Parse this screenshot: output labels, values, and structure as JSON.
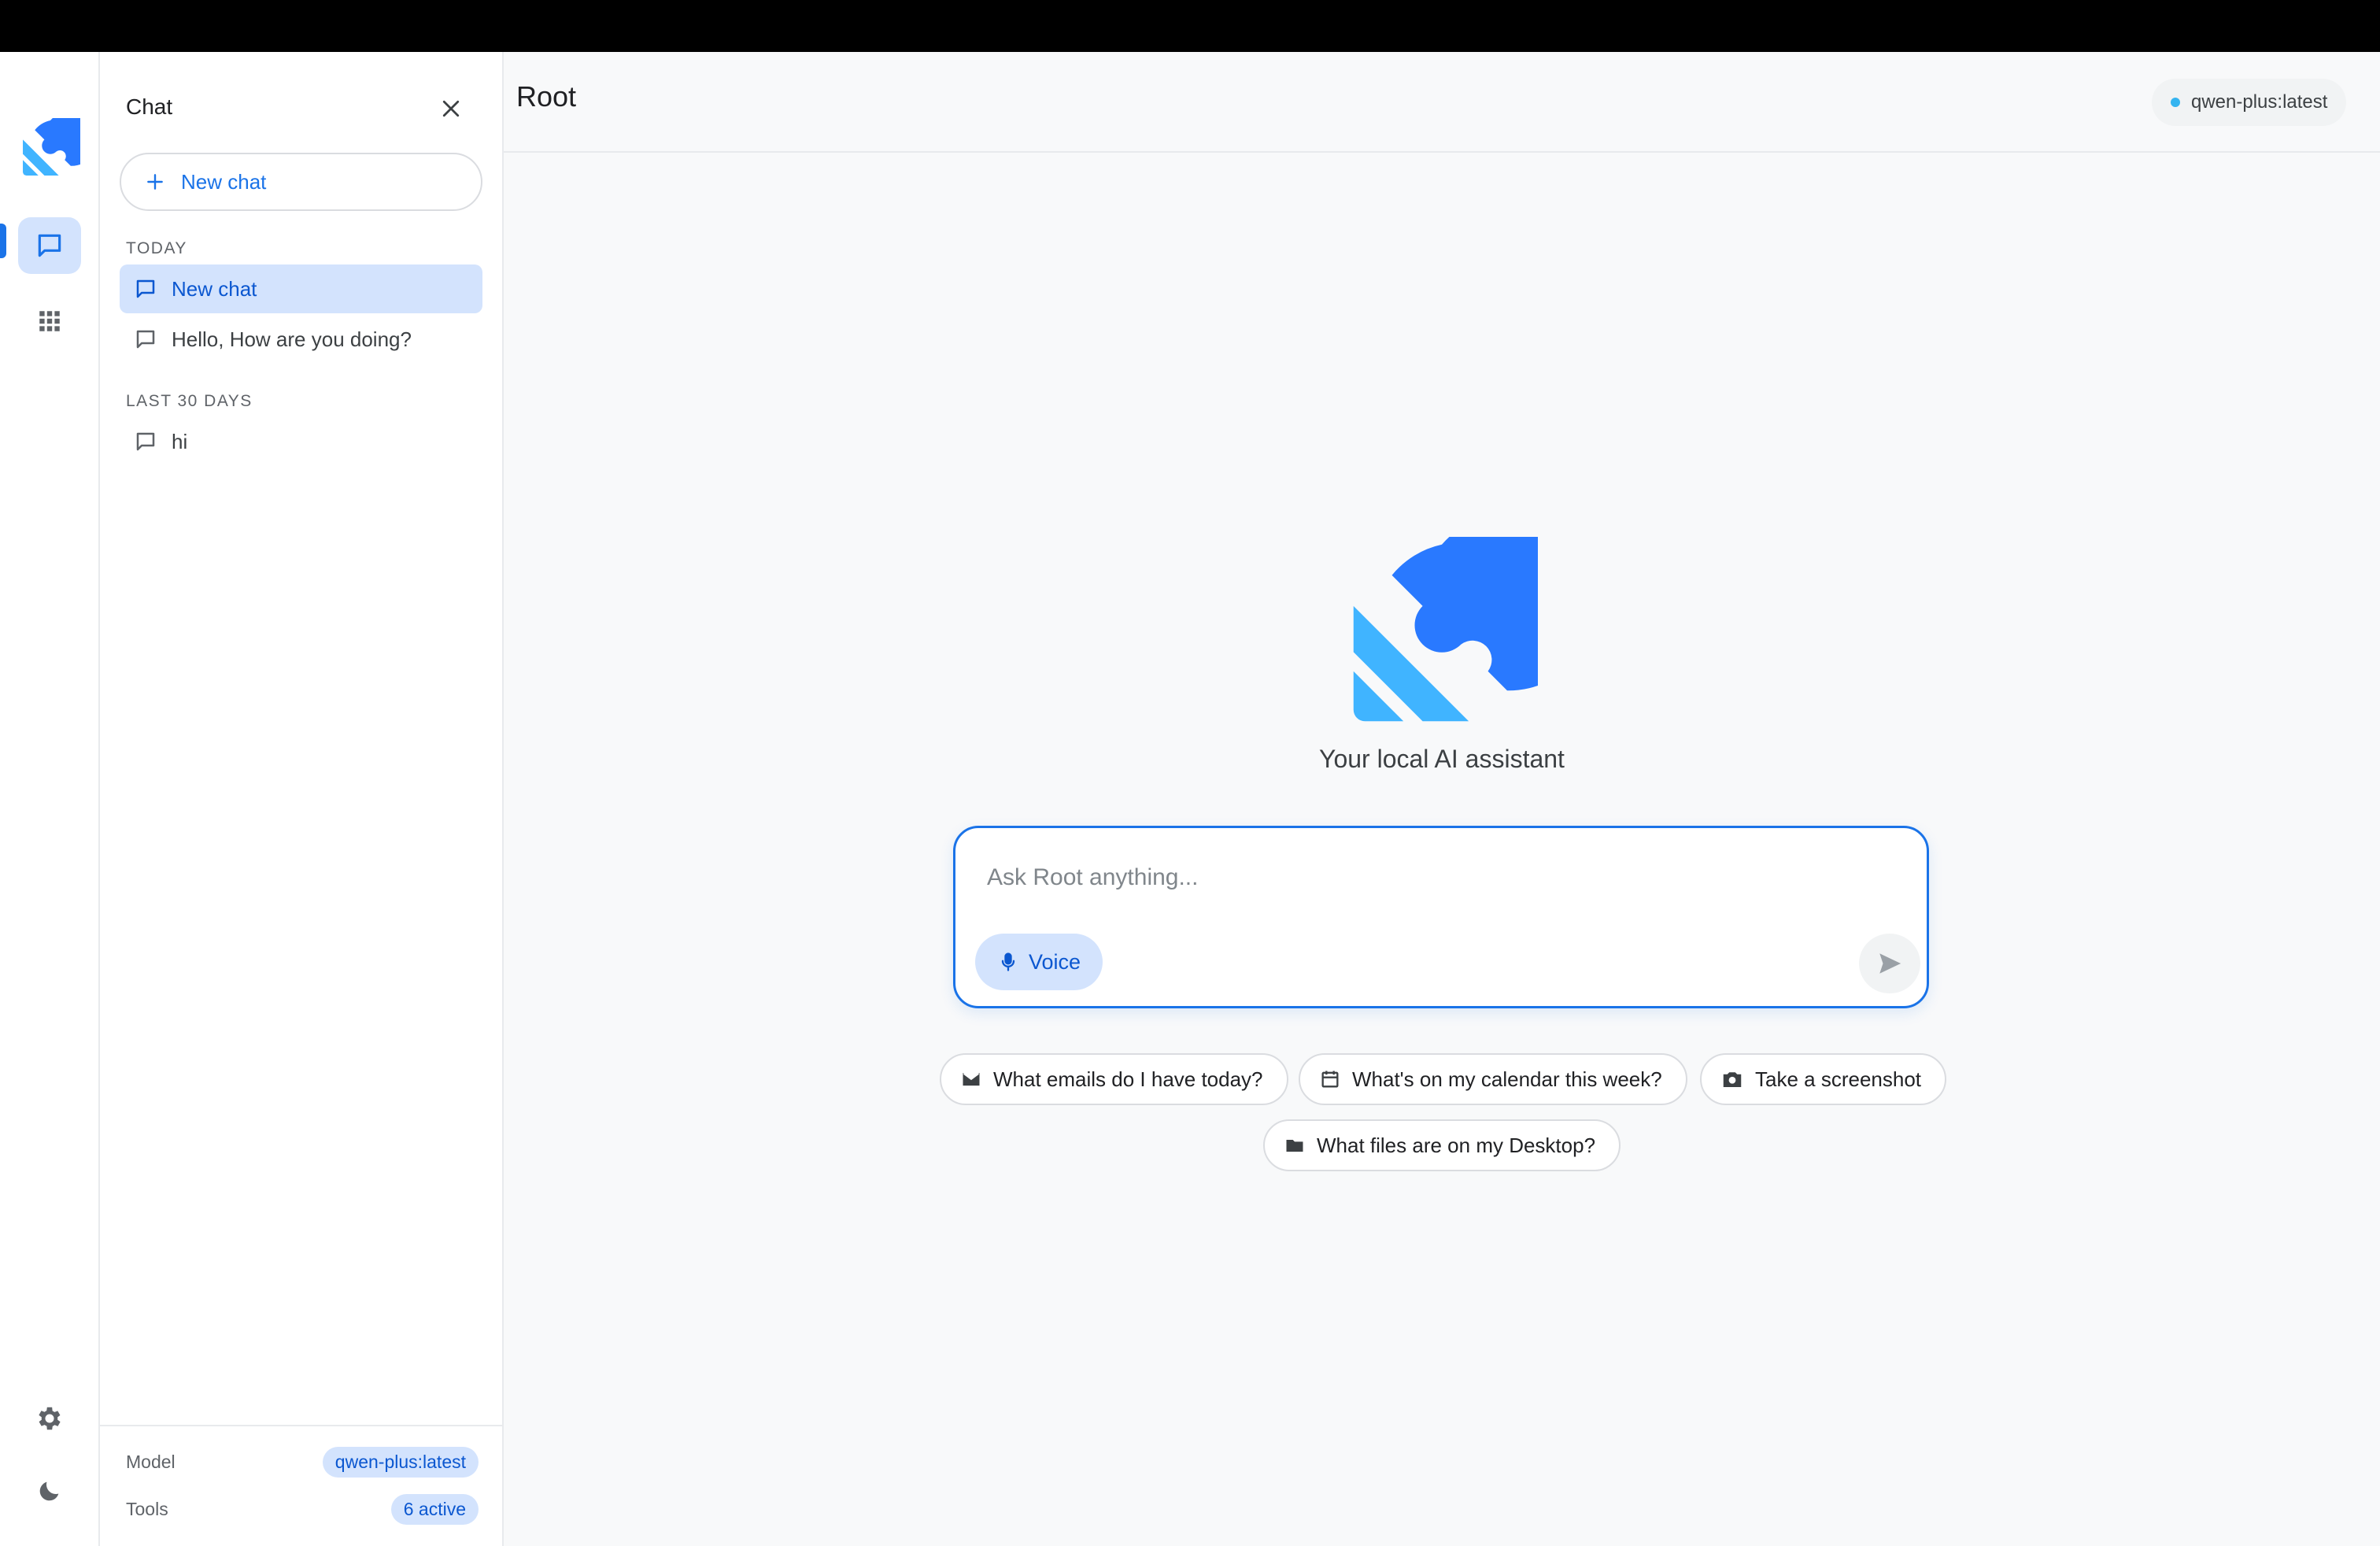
{
  "sidebar": {
    "title": "Chat",
    "new_chat_label": "New chat",
    "sections": [
      {
        "label": "TODAY",
        "items": [
          "New chat",
          "Hello, How are you doing?"
        ]
      },
      {
        "label": "LAST 30 DAYS",
        "items": [
          "hi"
        ]
      }
    ],
    "footer": {
      "model_label": "Model",
      "model_value": "qwen-plus:latest",
      "tools_label": "Tools",
      "tools_value": "6 active"
    }
  },
  "main": {
    "title": "Root",
    "model_pill": "qwen-plus:latest",
    "tagline": "Your local AI assistant",
    "composer": {
      "placeholder": "Ask Root anything...",
      "value": "",
      "voice_label": "Voice"
    },
    "suggestions": [
      "What emails do I have today?",
      "What's on my calendar this week?",
      "Take a screenshot",
      "What files are on my Desktop?"
    ]
  },
  "icons": {
    "rail": [
      "root-logo-icon",
      "chat-icon",
      "apps-grid-icon",
      "gear-icon",
      "moon-icon"
    ],
    "suggestions": [
      "mail-icon",
      "calendar-icon",
      "camera-icon",
      "folder-icon"
    ]
  },
  "colors": {
    "accent": "#1a73e8",
    "accent_soft": "#d3e3fd",
    "logo_dark_blue": "#2979ff",
    "logo_light_blue": "#40b4ff",
    "status_dot": "#34b4f0"
  }
}
